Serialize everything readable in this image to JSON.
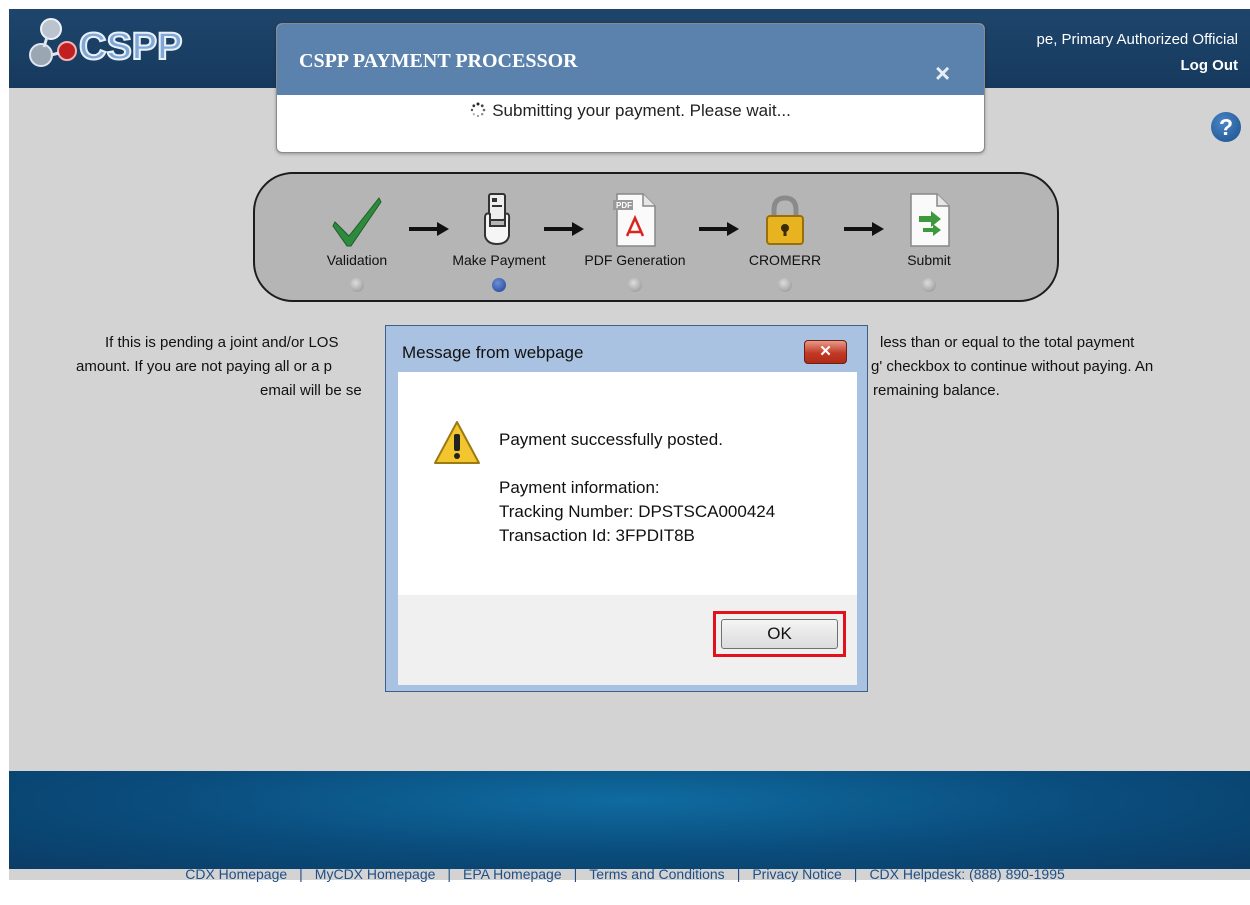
{
  "header": {
    "user_name": "pe, Primary Authorized Official",
    "logout_label": "Log Out"
  },
  "help_icon": "?",
  "steps": [
    {
      "label": "Validation",
      "icon": "checkmark-icon",
      "active": false
    },
    {
      "label": "Make Payment",
      "icon": "card-hand-icon",
      "active": true
    },
    {
      "label": "PDF Generation",
      "icon": "pdf-icon",
      "active": false
    },
    {
      "label": "CROMERR",
      "icon": "padlock-icon",
      "active": false
    },
    {
      "label": "Submit",
      "icon": "submit-document-icon",
      "active": false
    }
  ],
  "instructions": {
    "line1_left": "If this is pending a joint and/or LOS",
    "line1_right": "less than or equal to the total payment",
    "line2_left": "amount. If you are not paying all or a p",
    "line2_right": "g' checkbox to continue without paying. An",
    "line3_left": "email will be se",
    "line3_right": "remaining balance."
  },
  "processor_dialog": {
    "title": "CSPP PAYMENT PROCESSOR",
    "close_glyph": "×",
    "status": "Submitting your payment. Please wait..."
  },
  "message_dialog": {
    "title": "Message from webpage",
    "close_glyph": "✕",
    "message": "Payment successfully posted.",
    "info_heading": "Payment information:",
    "tracking": "Tracking Number: DPSTSCA000424",
    "transaction": "Transaction Id: 3FPDIT8B",
    "ok_label": "OK"
  },
  "footer": {
    "links": [
      "CDX Homepage",
      "MyCDX Homepage",
      "EPA Homepage",
      "Terms and Conditions",
      "Privacy Notice",
      "CDX Helpdesk: (888) 890-1995"
    ],
    "separator": "|"
  },
  "colors": {
    "header_bg": "#1f456c",
    "dialog_title_bar": "#5a82ad",
    "message_frame": "#a9c2e2",
    "ok_highlight": "#e1121c",
    "footer_link": "#1f4f86"
  }
}
